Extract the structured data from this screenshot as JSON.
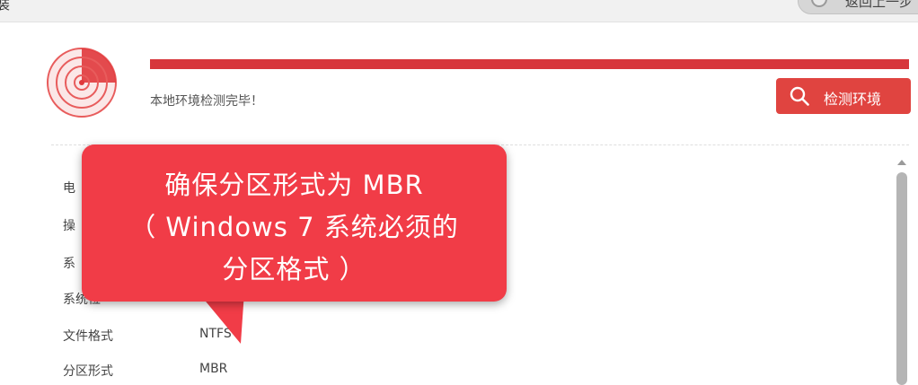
{
  "window": {
    "title": "装",
    "back_button_label": "返回上一步"
  },
  "progress": {
    "fraction": 1.0,
    "status": "本地环境检测完毕！"
  },
  "detect_button": {
    "label": "检测环境"
  },
  "info_rows": [
    {
      "label": "电",
      "value": ""
    },
    {
      "label": "操",
      "value": ""
    },
    {
      "label": "系",
      "value": ""
    },
    {
      "label": "系统位",
      "value": ""
    },
    {
      "label": "文件格式",
      "value": "NTFS"
    },
    {
      "label": "分区形式",
      "value": "MBR"
    }
  ],
  "callout": {
    "line1": "确保分区形式为 MBR",
    "line2": "（ Windows 7 系统必须的",
    "line3": "分区格式 ）"
  },
  "colors": {
    "accent": "#d7363b",
    "button": "#e04440",
    "callout": "#f13c47"
  }
}
